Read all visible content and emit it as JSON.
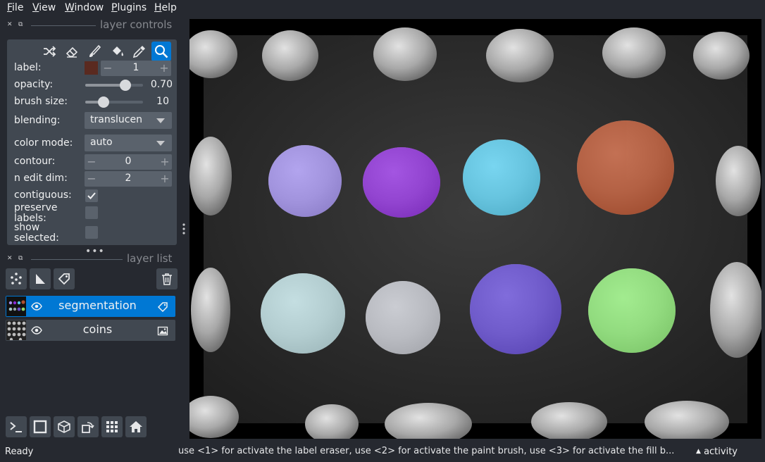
{
  "menubar": {
    "items": [
      {
        "mnemonic": "F",
        "rest": "ile"
      },
      {
        "mnemonic": "V",
        "rest": "iew"
      },
      {
        "mnemonic": "W",
        "rest": "indow"
      },
      {
        "mnemonic": "P",
        "rest": "lugins"
      },
      {
        "mnemonic": "H",
        "rest": "elp"
      }
    ]
  },
  "layer_controls": {
    "title": "layer controls",
    "tools": [
      "shuffle-colors-icon",
      "eraser-icon",
      "paint-brush-icon",
      "fill-bucket-icon",
      "color-picker-icon",
      "pan-zoom-icon"
    ],
    "active_tool": "pan-zoom-icon",
    "label": {
      "text": "label:",
      "value": "1",
      "swatch_color": "#5a2a20"
    },
    "opacity": {
      "text": "opacity:",
      "value": "0.70",
      "level": 0.7
    },
    "brush_size": {
      "text": "brush size:",
      "value": "10",
      "level": 0.1
    },
    "blending": {
      "text": "blending:",
      "value": "translucen"
    },
    "color_mode": {
      "text": "color mode:",
      "value": "auto"
    },
    "contour": {
      "text": "contour:",
      "value": "0"
    },
    "n_edit_dim": {
      "text": "n edit dim:",
      "value": "2"
    },
    "contiguous": {
      "text": "contiguous:",
      "checked": true
    },
    "preserve_labels": {
      "text1": "preserve",
      "text2": "labels:",
      "checked": false
    },
    "show_selected": {
      "text1": "show",
      "text2": "selected:",
      "checked": false
    }
  },
  "layer_list": {
    "title": "layer list",
    "layers": [
      {
        "name": "segmentation",
        "selected": true,
        "type_icon": "label-tag-icon"
      },
      {
        "name": "coins",
        "selected": false,
        "type_icon": "image-icon"
      }
    ]
  },
  "colors": {
    "accent": "#0078d4",
    "panel": "#414851",
    "background": "#262930"
  },
  "status": {
    "left": "Ready",
    "hint": "use <1> for activate the label eraser, use <2> for activate the paint brush, use <3> for activate the fill b...",
    "activity": "activity"
  }
}
